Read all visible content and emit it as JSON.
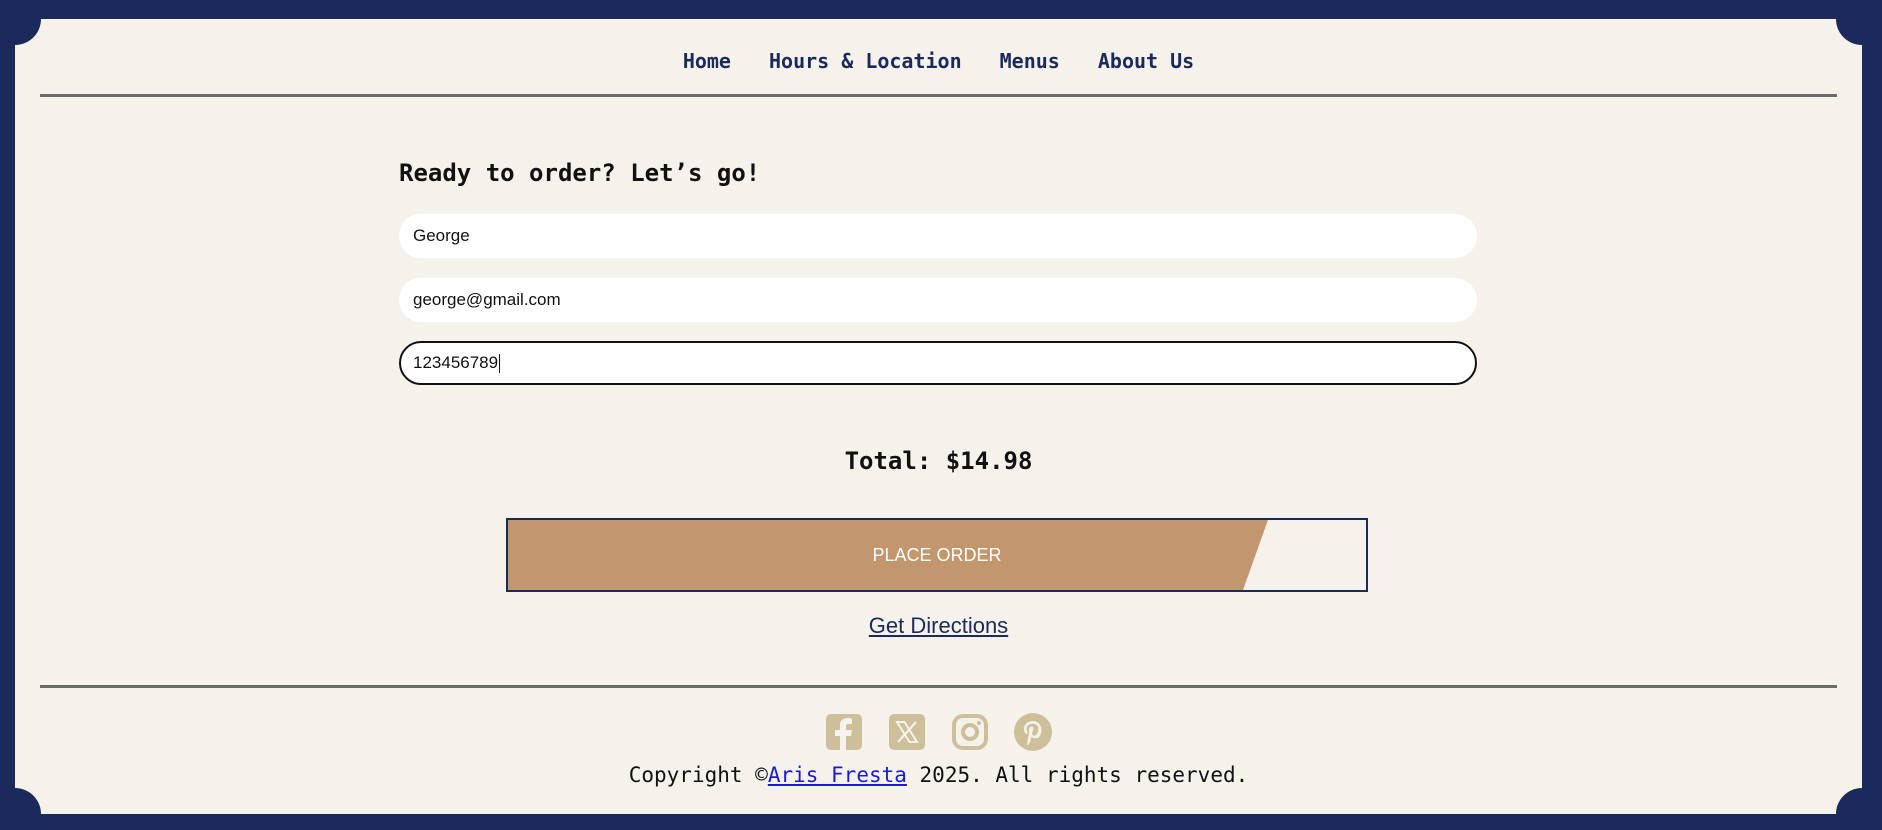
{
  "nav": {
    "items": [
      {
        "label": "Home"
      },
      {
        "label": "Hours & Location"
      },
      {
        "label": "Menus"
      },
      {
        "label": "About Us"
      }
    ]
  },
  "form": {
    "heading": "Ready to order? Let’s go!",
    "name_value": "George",
    "email_value": "george@gmail.com",
    "phone_value": "123456789"
  },
  "order": {
    "total_label": "Total: $14.98",
    "place_order_label": "PLACE ORDER",
    "directions_label": "Get Directions"
  },
  "footer": {
    "social_icons": [
      "facebook-icon",
      "x-icon",
      "instagram-icon",
      "pinterest-icon"
    ],
    "copyright_prefix": "Copyright ©",
    "author": "Aris Fresta",
    "copyright_suffix": " 2025. All rights reserved."
  },
  "colors": {
    "background": "#1b2a5a",
    "card": "#f5f2ec",
    "accent": "#c3976e",
    "icon": "#cdbf99",
    "nav_text": "#1b2a5a"
  }
}
